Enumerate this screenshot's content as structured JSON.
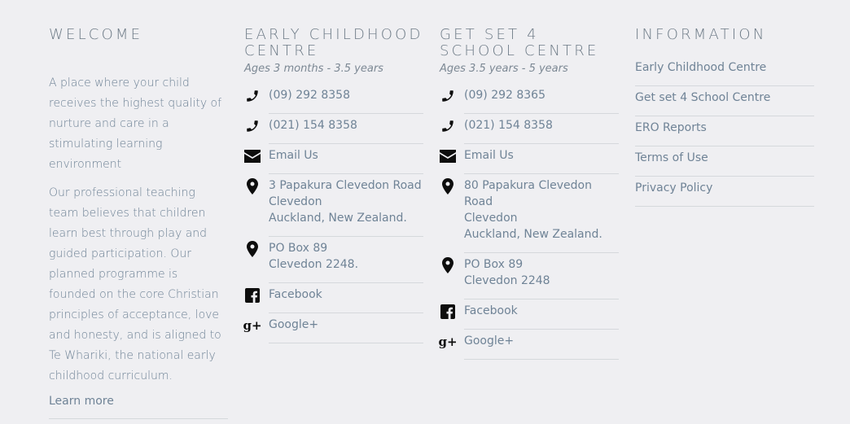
{
  "welcome": {
    "title": "WELCOME",
    "paragraphs": [
      "A place where your child receives the highest quality of nurture and care in a stimulating learning environment",
      "Our professional teaching team believes that children learn best through play and guided participation. Our planned programme is founded on the core Christian principles of acceptance, love and honesty, and is aligned to Te Whariki, the national early childhood curriculum."
    ],
    "learn_more": "Learn more"
  },
  "early": {
    "title_line1": "EARLY CHILDHOOD",
    "title_line2": "CENTRE",
    "ages": "Ages 3 months - 3.5 years",
    "phone1": "(09) 292 8358",
    "phone2": "(021) 154 8358",
    "email": "Email Us",
    "address_line1": "3 Papakura Clevedon Road",
    "address_line2": "Clevedon",
    "address_line3": "Auckland, New Zealand.",
    "po_line1": "PO Box 89",
    "po_line2": "Clevedon 2248.",
    "facebook": "Facebook",
    "googleplus": "Google+"
  },
  "school": {
    "title_line1": "GET SET 4",
    "title_line2": "SCHOOL CENTRE",
    "ages": "Ages 3.5 years - 5 years",
    "phone1": "(09) 292 8365",
    "phone2": "(021) 154 8358",
    "email": "Email Us",
    "address_line1": "80 Papakura Clevedon Road",
    "address_line2": "Clevedon",
    "address_line3": "Auckland, New Zealand.",
    "po_line1": "PO Box 89",
    "po_line2": "Clevedon 2248",
    "facebook": "Facebook",
    "googleplus": "Google+"
  },
  "information": {
    "title": "INFORMATION",
    "links": [
      "Early Childhood Centre",
      "Get set 4 School Centre",
      "ERO Reports",
      "Terms of Use",
      "Privacy Policy"
    ]
  },
  "icons": {
    "phone": "phone-icon",
    "email": "envelope-icon",
    "location": "map-marker-icon",
    "facebook": "facebook-icon",
    "googleplus": "google-plus-icon"
  },
  "colors": {
    "background": "#efeff2",
    "text": "#6f8396",
    "heading": "#6d7a86",
    "icon": "#0d0d0d",
    "divider": "#d5d8dc"
  }
}
